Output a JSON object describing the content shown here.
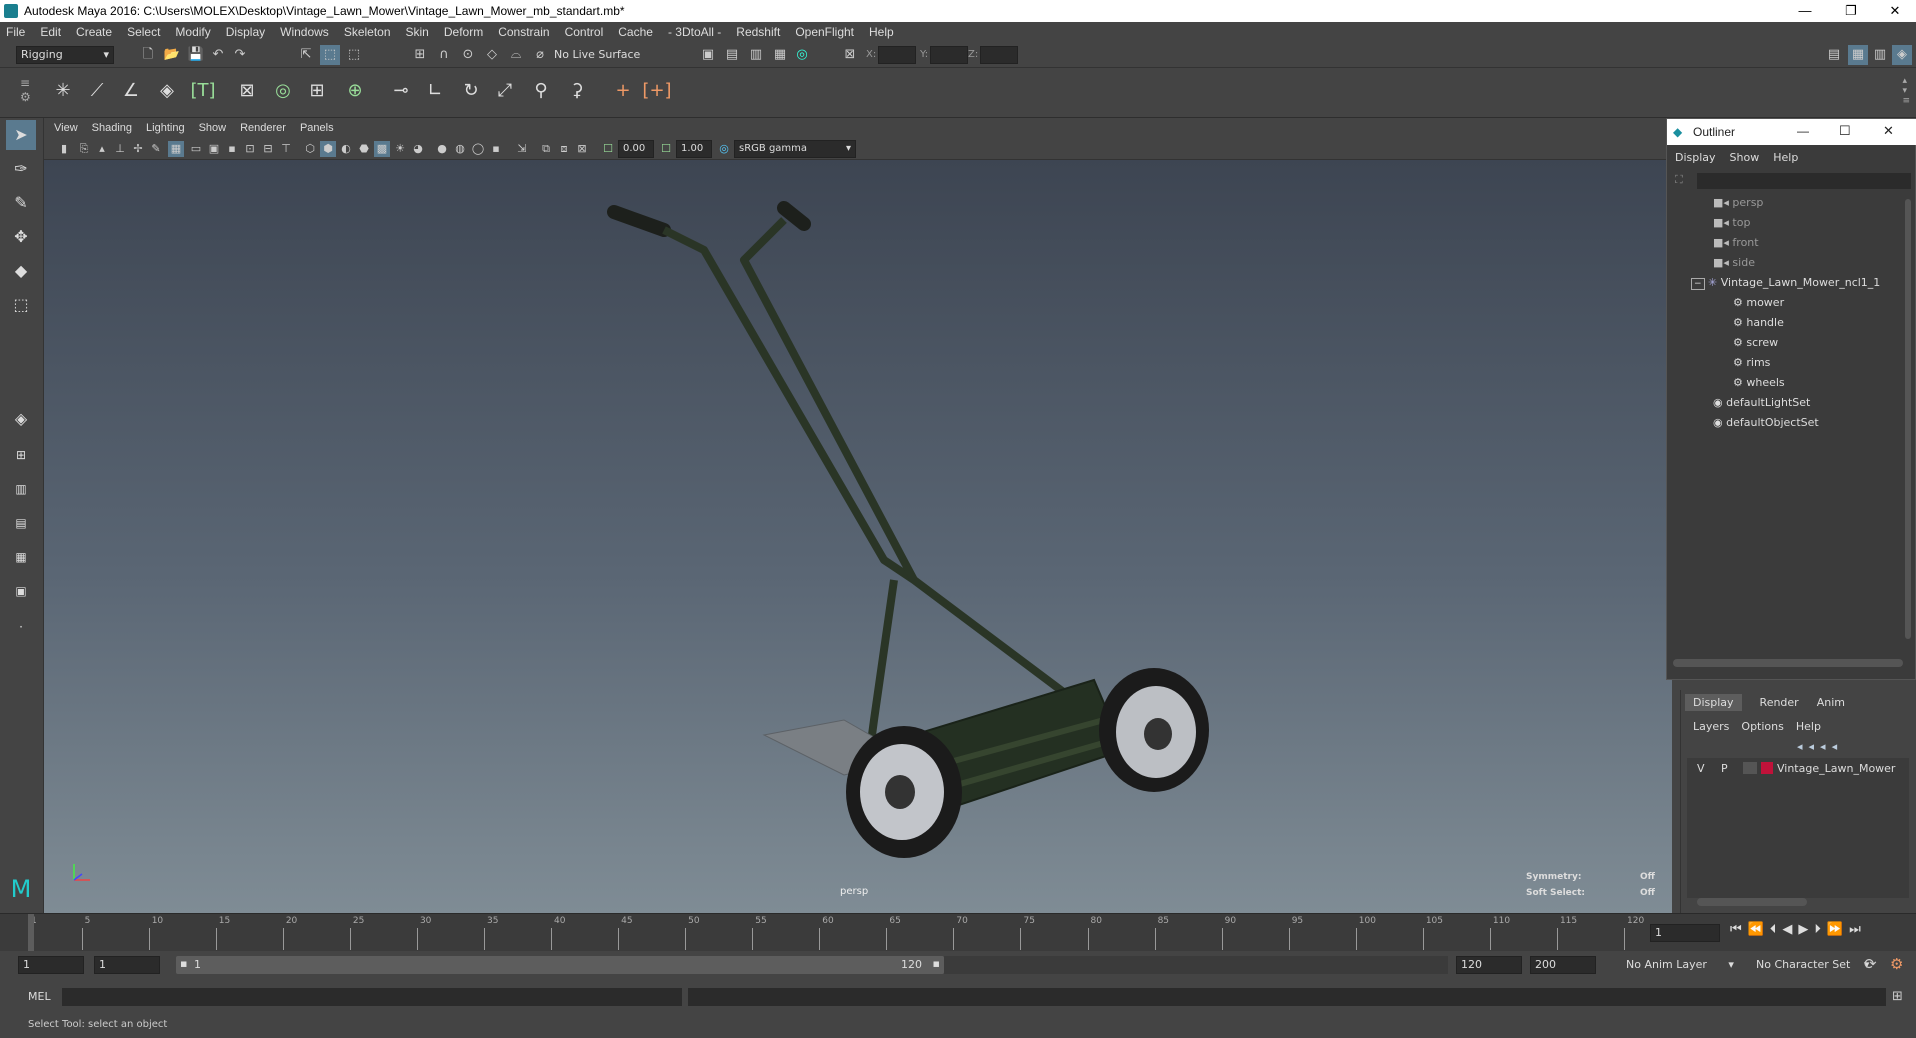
{
  "window": {
    "title": "Autodesk Maya 2016: C:\\Users\\MOLEX\\Desktop\\Vintage_Lawn_Mower\\Vintage_Lawn_Mower_mb_standart.mb*"
  },
  "menu": [
    "File",
    "Edit",
    "Create",
    "Select",
    "Modify",
    "Display",
    "Windows",
    "Skeleton",
    "Skin",
    "Deform",
    "Constrain",
    "Control",
    "Cache",
    "- 3DtoAll -",
    "Redshift",
    "OpenFlight",
    "Help"
  ],
  "status": {
    "mode": "Rigging",
    "live_surface": "No Live Surface",
    "x_label": "X:",
    "y_label": "Y:",
    "z_label": "Z:"
  },
  "panel_menu": [
    "View",
    "Shading",
    "Lighting",
    "Show",
    "Renderer",
    "Panels"
  ],
  "panel_toolbar": {
    "exposure": "0.00",
    "gamma": "1.00",
    "color_space": "sRGB gamma"
  },
  "viewport": {
    "camera_label": "persp",
    "symmetry_label": "Symmetry:",
    "symmetry_value": "Off",
    "soft_select_label": "Soft Select:",
    "soft_select_value": "Off"
  },
  "outliner": {
    "title": "Outliner",
    "menu": [
      "Display",
      "Show",
      "Help"
    ],
    "items": [
      {
        "label": "persp",
        "dim": true
      },
      {
        "label": "top",
        "dim": true
      },
      {
        "label": "front",
        "dim": true
      },
      {
        "label": "side",
        "dim": true
      },
      {
        "label": "Vintage_Lawn_Mower_ncl1_1",
        "dim": false
      },
      {
        "label": "mower",
        "dim": false
      },
      {
        "label": "handle",
        "dim": false
      },
      {
        "label": "screw",
        "dim": false
      },
      {
        "label": "rims",
        "dim": false
      },
      {
        "label": "wheels",
        "dim": false
      },
      {
        "label": "defaultLightSet",
        "dim": false
      },
      {
        "label": "defaultObjectSet",
        "dim": false
      }
    ]
  },
  "layers": {
    "tabs": [
      "Display",
      "Render",
      "Anim"
    ],
    "menu": [
      "Layers",
      "Options",
      "Help"
    ],
    "row": {
      "v": "V",
      "p": "P",
      "name": "Vintage_Lawn_Mower",
      "color": "#c0123a"
    }
  },
  "timeline": {
    "ticks": [
      "1",
      "5",
      "10",
      "15",
      "20",
      "25",
      "30",
      "35",
      "40",
      "45",
      "50",
      "55",
      "60",
      "65",
      "70",
      "75",
      "80",
      "85",
      "90",
      "95",
      "100",
      "105",
      "110",
      "115",
      "120"
    ],
    "current_frame": "1"
  },
  "range": {
    "start": "1",
    "inner_start": "1",
    "slider_start": "1",
    "slider_end": "120",
    "end": "120",
    "max": "200",
    "anim_layer": "No Anim Layer",
    "char_set": "No Character Set"
  },
  "mel": {
    "label": "MEL"
  },
  "help_line": "Select Tool: select an object"
}
